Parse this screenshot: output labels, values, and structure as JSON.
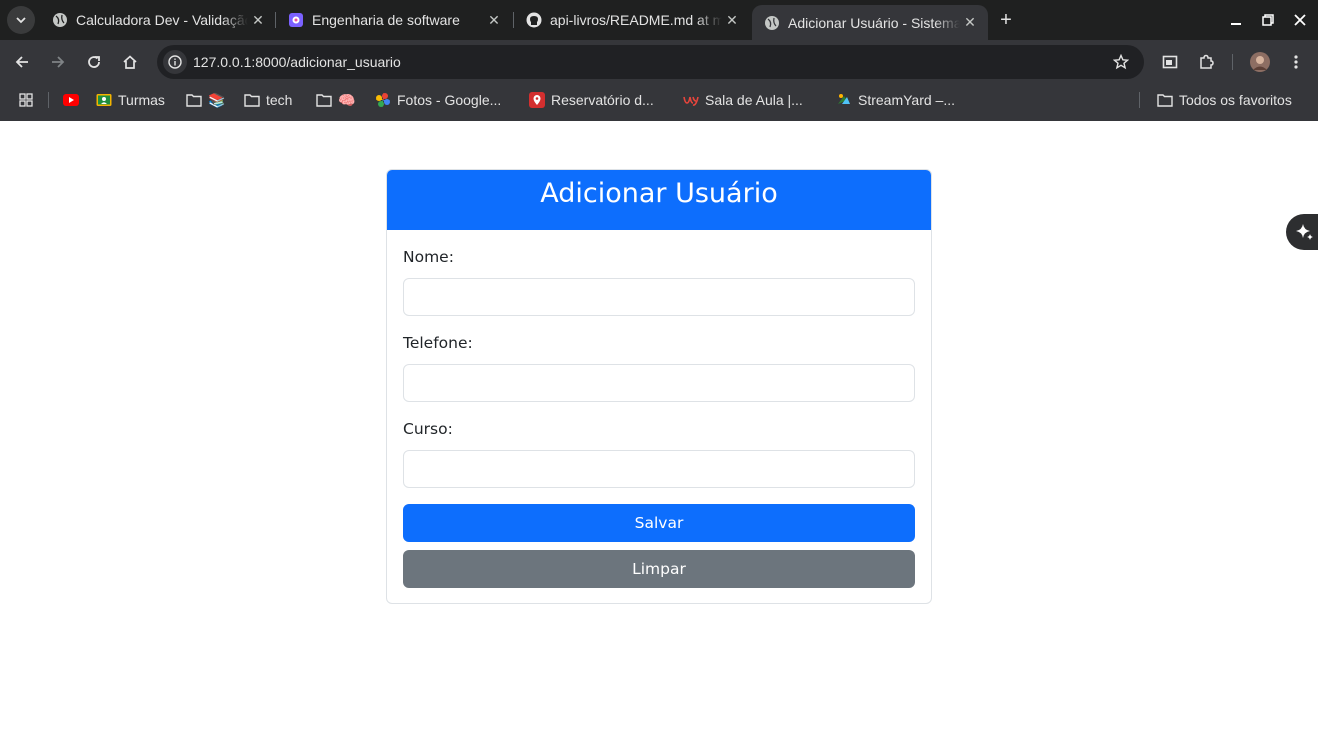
{
  "browser": {
    "tabs": [
      {
        "title": "Calculadora Dev - Validação",
        "icon": "globe-icon"
      },
      {
        "title": "Engenharia de software",
        "icon": "app-icon"
      },
      {
        "title": "api-livros/README.md at main",
        "icon": "github-icon"
      },
      {
        "title": "Adicionar Usuário - Sistema",
        "icon": "globe-icon",
        "active": true
      }
    ],
    "new_tab_label": "+",
    "url": "127.0.0.1:8000/adicionar_usuario",
    "bookmarks": [
      {
        "label": "",
        "icon": "youtube-icon"
      },
      {
        "label": "Turmas",
        "icon": "classroom-icon"
      },
      {
        "label": "📚",
        "icon": "folder-icon"
      },
      {
        "label": "tech",
        "icon": "folder-icon"
      },
      {
        "label": "🧠",
        "icon": "folder-icon"
      },
      {
        "label": "Fotos - Google...",
        "icon": "google-photos-icon"
      },
      {
        "label": "Reservatório d...",
        "icon": "location-pin-icon"
      },
      {
        "label": "Sala de Aula |...",
        "icon": "uy-icon"
      },
      {
        "label": "StreamYard –...",
        "icon": "streamyard-icon"
      }
    ],
    "all_bookmarks_label": "Todos os favoritos"
  },
  "form": {
    "title": "Adicionar Usuário",
    "fields": [
      {
        "label": "Nome:",
        "value": ""
      },
      {
        "label": "Telefone:",
        "value": ""
      },
      {
        "label": "Curso:",
        "value": ""
      }
    ],
    "save_label": "Salvar",
    "clear_label": "Limpar"
  },
  "colors": {
    "primary": "#0d6efd",
    "secondary": "#6c757d",
    "chrome_dark": "#1f2020",
    "chrome_toolbar": "#35363a"
  }
}
